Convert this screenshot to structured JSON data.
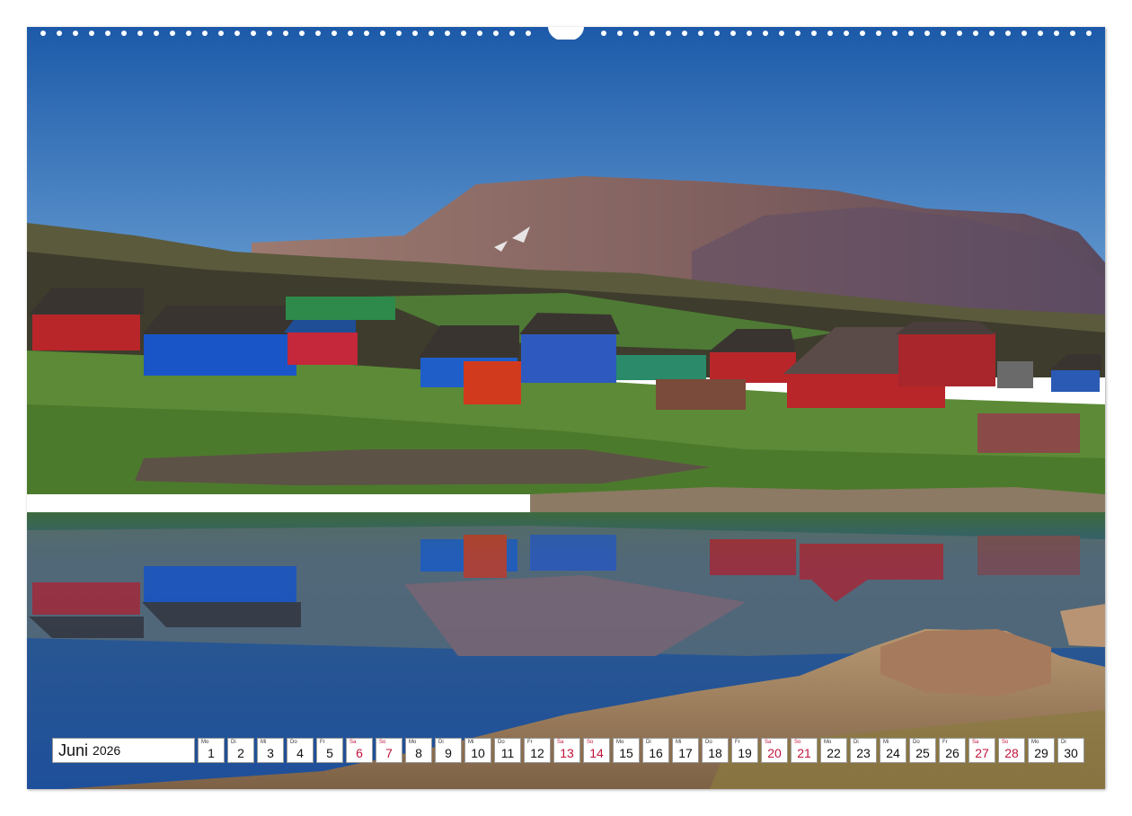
{
  "calendar": {
    "month": "Juni",
    "year": "2026",
    "days": [
      {
        "abbr": "Mo",
        "num": "1",
        "weekend": false
      },
      {
        "abbr": "Di",
        "num": "2",
        "weekend": false
      },
      {
        "abbr": "Mi",
        "num": "3",
        "weekend": false
      },
      {
        "abbr": "Do",
        "num": "4",
        "weekend": false
      },
      {
        "abbr": "Fr",
        "num": "5",
        "weekend": false
      },
      {
        "abbr": "Sa",
        "num": "6",
        "weekend": true
      },
      {
        "abbr": "So",
        "num": "7",
        "weekend": true
      },
      {
        "abbr": "Mo",
        "num": "8",
        "weekend": false
      },
      {
        "abbr": "Di",
        "num": "9",
        "weekend": false
      },
      {
        "abbr": "Mi",
        "num": "10",
        "weekend": false
      },
      {
        "abbr": "Do",
        "num": "11",
        "weekend": false
      },
      {
        "abbr": "Fr",
        "num": "12",
        "weekend": false
      },
      {
        "abbr": "Sa",
        "num": "13",
        "weekend": true
      },
      {
        "abbr": "So",
        "num": "14",
        "weekend": true
      },
      {
        "abbr": "Mo",
        "num": "15",
        "weekend": false
      },
      {
        "abbr": "Di",
        "num": "16",
        "weekend": false
      },
      {
        "abbr": "Mi",
        "num": "17",
        "weekend": false
      },
      {
        "abbr": "Do",
        "num": "18",
        "weekend": false
      },
      {
        "abbr": "Fr",
        "num": "19",
        "weekend": false
      },
      {
        "abbr": "Sa",
        "num": "20",
        "weekend": true
      },
      {
        "abbr": "So",
        "num": "21",
        "weekend": true
      },
      {
        "abbr": "Mo",
        "num": "22",
        "weekend": false
      },
      {
        "abbr": "Di",
        "num": "23",
        "weekend": false
      },
      {
        "abbr": "Mi",
        "num": "24",
        "weekend": false
      },
      {
        "abbr": "Do",
        "num": "25",
        "weekend": false
      },
      {
        "abbr": "Fr",
        "num": "26",
        "weekend": false
      },
      {
        "abbr": "Sa",
        "num": "27",
        "weekend": true
      },
      {
        "abbr": "So",
        "num": "28",
        "weekend": true
      },
      {
        "abbr": "Mo",
        "num": "29",
        "weekend": false
      },
      {
        "abbr": "Di",
        "num": "30",
        "weekend": false
      }
    ]
  },
  "colors": {
    "weekend_text": "#c0143c",
    "sky_top": "#1f5fae",
    "sky_bottom": "#5d96cf",
    "mountain": "#8a6a63",
    "water": "#2f5f9e"
  }
}
